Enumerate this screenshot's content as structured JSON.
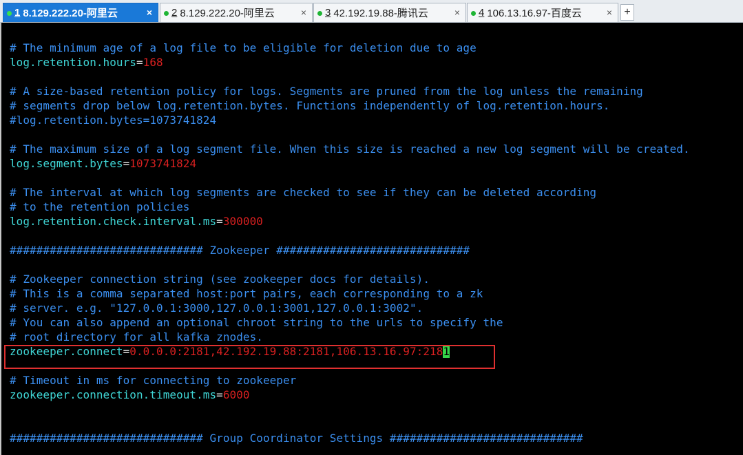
{
  "tabs": [
    {
      "num": "1",
      "label": "8.129.222.20-阿里云",
      "active": true
    },
    {
      "num": "2",
      "label": "8.129.222.20-阿里云",
      "active": false
    },
    {
      "num": "3",
      "label": "42.192.19.88-腾讯云",
      "active": false
    },
    {
      "num": "4",
      "label": "106.13.16.97-百度云",
      "active": false
    }
  ],
  "tab_close": "×",
  "new_tab": "+",
  "terminal": {
    "l1": "# The minimum age of a log file to be eligible for deletion due to age",
    "l2": {
      "key": "log.retention.hours",
      "eq": "=",
      "val": "168"
    },
    "l3": "# A size-based retention policy for logs. Segments are pruned from the log unless the remaining",
    "l4": "# segments drop below log.retention.bytes. Functions independently of log.retention.hours.",
    "l5": "#log.retention.bytes=1073741824",
    "l6": "# The maximum size of a log segment file. When this size is reached a new log segment will be created.",
    "l7": {
      "key": "log.segment.bytes",
      "eq": "=",
      "val": "1073741824"
    },
    "l8": "# The interval at which log segments are checked to see if they can be deleted according",
    "l9": "# to the retention policies",
    "l10": {
      "key": "log.retention.check.interval.ms",
      "eq": "=",
      "val": "300000"
    },
    "l11": "############################# Zookeeper #############################",
    "l12": "# Zookeeper connection string (see zookeeper docs for details).",
    "l13": "# This is a comma separated host:port pairs, each corresponding to a zk",
    "l14": "# server. e.g. \"127.0.0.1:3000,127.0.0.1:3001,127.0.0.1:3002\".",
    "l15": "# You can also append an optional chroot string to the urls to specify the",
    "l16": "# root directory for all kafka znodes.",
    "l17": {
      "key": "zookeeper.connect",
      "eq": "=",
      "val": "0.0.0.0:2181,42.192.19.88:2181,106.13.16.97:218",
      "cursor": "1"
    },
    "l18": "# Timeout in ms for connecting to zookeeper",
    "l19": {
      "key": "zookeeper.connection.timeout.ms",
      "eq": "=",
      "val": "6000"
    },
    "l20": "############################# Group Coordinator Settings #############################"
  }
}
